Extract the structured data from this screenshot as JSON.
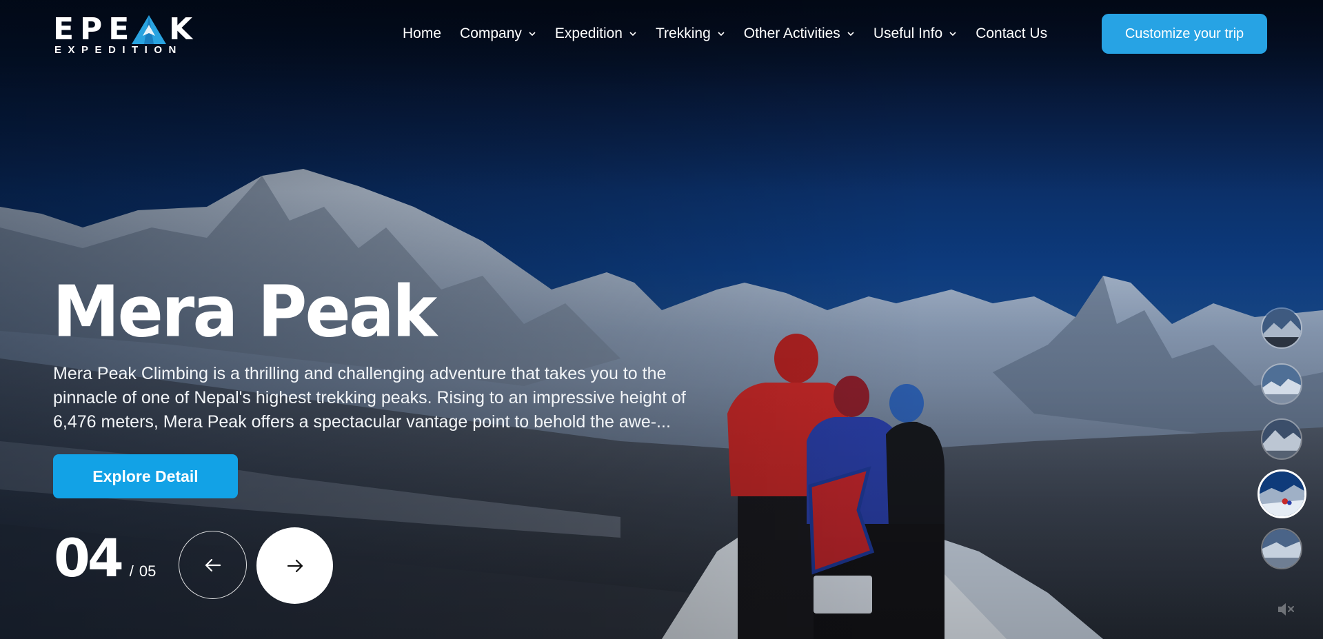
{
  "brand": {
    "logo_main": "EPEAK",
    "logo_sub": "EXPEDITION"
  },
  "nav": {
    "items": [
      {
        "label": "Home",
        "dropdown": false
      },
      {
        "label": "Company",
        "dropdown": true
      },
      {
        "label": "Expedition",
        "dropdown": true
      },
      {
        "label": "Trekking",
        "dropdown": true
      },
      {
        "label": "Other Activities",
        "dropdown": true
      },
      {
        "label": "Useful Info",
        "dropdown": true
      },
      {
        "label": "Contact Us",
        "dropdown": false
      }
    ],
    "cta_label": "Customize your trip"
  },
  "hero": {
    "title": "Mera Peak",
    "description": "Mera Peak Climbing is a thrilling and challenging adventure that takes you to the pinnacle of one of Nepal's highest trekking peaks. Rising to an impressive height of 6,476 meters, Mera Peak offers a spectacular vantage point to behold the awe-...",
    "explore_label": "Explore Detail"
  },
  "slider": {
    "current": "04",
    "separator": "/",
    "total": "05",
    "active_index": 4,
    "thumbnail_count": 5
  },
  "icons": {
    "prev": "arrow-left-icon",
    "next": "arrow-right-icon",
    "dropdown": "chevron-down-icon",
    "mute": "volume-mute-icon"
  },
  "colors": {
    "accent": "#27a3e4",
    "button": "#12a2e6",
    "sky_top": "#05122b",
    "sky_mid": "#0c3a7a"
  }
}
